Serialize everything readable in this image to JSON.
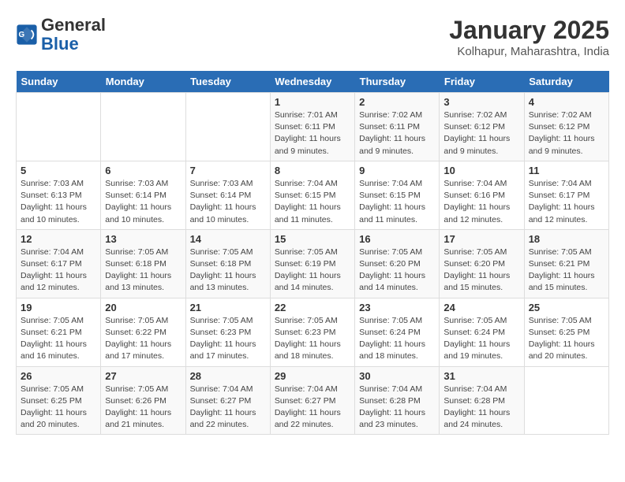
{
  "header": {
    "logo_line1": "General",
    "logo_line2": "Blue",
    "month_year": "January 2025",
    "location": "Kolhapur, Maharashtra, India"
  },
  "weekdays": [
    "Sunday",
    "Monday",
    "Tuesday",
    "Wednesday",
    "Thursday",
    "Friday",
    "Saturday"
  ],
  "weeks": [
    [
      {
        "day": "",
        "detail": ""
      },
      {
        "day": "",
        "detail": ""
      },
      {
        "day": "",
        "detail": ""
      },
      {
        "day": "1",
        "detail": "Sunrise: 7:01 AM\nSunset: 6:11 PM\nDaylight: 11 hours\nand 9 minutes."
      },
      {
        "day": "2",
        "detail": "Sunrise: 7:02 AM\nSunset: 6:11 PM\nDaylight: 11 hours\nand 9 minutes."
      },
      {
        "day": "3",
        "detail": "Sunrise: 7:02 AM\nSunset: 6:12 PM\nDaylight: 11 hours\nand 9 minutes."
      },
      {
        "day": "4",
        "detail": "Sunrise: 7:02 AM\nSunset: 6:12 PM\nDaylight: 11 hours\nand 9 minutes."
      }
    ],
    [
      {
        "day": "5",
        "detail": "Sunrise: 7:03 AM\nSunset: 6:13 PM\nDaylight: 11 hours\nand 10 minutes."
      },
      {
        "day": "6",
        "detail": "Sunrise: 7:03 AM\nSunset: 6:14 PM\nDaylight: 11 hours\nand 10 minutes."
      },
      {
        "day": "7",
        "detail": "Sunrise: 7:03 AM\nSunset: 6:14 PM\nDaylight: 11 hours\nand 10 minutes."
      },
      {
        "day": "8",
        "detail": "Sunrise: 7:04 AM\nSunset: 6:15 PM\nDaylight: 11 hours\nand 11 minutes."
      },
      {
        "day": "9",
        "detail": "Sunrise: 7:04 AM\nSunset: 6:15 PM\nDaylight: 11 hours\nand 11 minutes."
      },
      {
        "day": "10",
        "detail": "Sunrise: 7:04 AM\nSunset: 6:16 PM\nDaylight: 11 hours\nand 12 minutes."
      },
      {
        "day": "11",
        "detail": "Sunrise: 7:04 AM\nSunset: 6:17 PM\nDaylight: 11 hours\nand 12 minutes."
      }
    ],
    [
      {
        "day": "12",
        "detail": "Sunrise: 7:04 AM\nSunset: 6:17 PM\nDaylight: 11 hours\nand 12 minutes."
      },
      {
        "day": "13",
        "detail": "Sunrise: 7:05 AM\nSunset: 6:18 PM\nDaylight: 11 hours\nand 13 minutes."
      },
      {
        "day": "14",
        "detail": "Sunrise: 7:05 AM\nSunset: 6:18 PM\nDaylight: 11 hours\nand 13 minutes."
      },
      {
        "day": "15",
        "detail": "Sunrise: 7:05 AM\nSunset: 6:19 PM\nDaylight: 11 hours\nand 14 minutes."
      },
      {
        "day": "16",
        "detail": "Sunrise: 7:05 AM\nSunset: 6:20 PM\nDaylight: 11 hours\nand 14 minutes."
      },
      {
        "day": "17",
        "detail": "Sunrise: 7:05 AM\nSunset: 6:20 PM\nDaylight: 11 hours\nand 15 minutes."
      },
      {
        "day": "18",
        "detail": "Sunrise: 7:05 AM\nSunset: 6:21 PM\nDaylight: 11 hours\nand 15 minutes."
      }
    ],
    [
      {
        "day": "19",
        "detail": "Sunrise: 7:05 AM\nSunset: 6:21 PM\nDaylight: 11 hours\nand 16 minutes."
      },
      {
        "day": "20",
        "detail": "Sunrise: 7:05 AM\nSunset: 6:22 PM\nDaylight: 11 hours\nand 17 minutes."
      },
      {
        "day": "21",
        "detail": "Sunrise: 7:05 AM\nSunset: 6:23 PM\nDaylight: 11 hours\nand 17 minutes."
      },
      {
        "day": "22",
        "detail": "Sunrise: 7:05 AM\nSunset: 6:23 PM\nDaylight: 11 hours\nand 18 minutes."
      },
      {
        "day": "23",
        "detail": "Sunrise: 7:05 AM\nSunset: 6:24 PM\nDaylight: 11 hours\nand 18 minutes."
      },
      {
        "day": "24",
        "detail": "Sunrise: 7:05 AM\nSunset: 6:24 PM\nDaylight: 11 hours\nand 19 minutes."
      },
      {
        "day": "25",
        "detail": "Sunrise: 7:05 AM\nSunset: 6:25 PM\nDaylight: 11 hours\nand 20 minutes."
      }
    ],
    [
      {
        "day": "26",
        "detail": "Sunrise: 7:05 AM\nSunset: 6:25 PM\nDaylight: 11 hours\nand 20 minutes."
      },
      {
        "day": "27",
        "detail": "Sunrise: 7:05 AM\nSunset: 6:26 PM\nDaylight: 11 hours\nand 21 minutes."
      },
      {
        "day": "28",
        "detail": "Sunrise: 7:04 AM\nSunset: 6:27 PM\nDaylight: 11 hours\nand 22 minutes."
      },
      {
        "day": "29",
        "detail": "Sunrise: 7:04 AM\nSunset: 6:27 PM\nDaylight: 11 hours\nand 22 minutes."
      },
      {
        "day": "30",
        "detail": "Sunrise: 7:04 AM\nSunset: 6:28 PM\nDaylight: 11 hours\nand 23 minutes."
      },
      {
        "day": "31",
        "detail": "Sunrise: 7:04 AM\nSunset: 6:28 PM\nDaylight: 11 hours\nand 24 minutes."
      },
      {
        "day": "",
        "detail": ""
      }
    ]
  ]
}
